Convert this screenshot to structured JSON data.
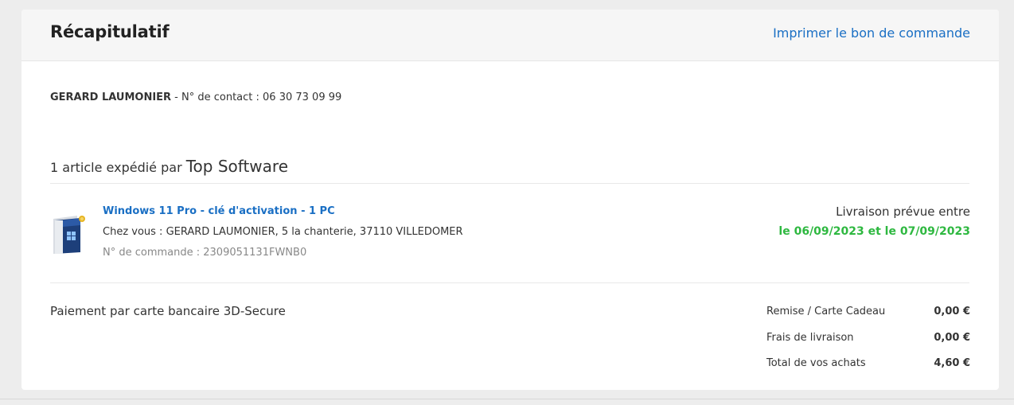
{
  "header": {
    "title": "Récapitulatif",
    "print_link": "Imprimer le bon de commande"
  },
  "contact": {
    "name": "GERARD LAUMONIER",
    "details": " - N° de contact : 06 30 73 09 99"
  },
  "shipment": {
    "prefix": "1 article expédié par ",
    "seller": "Top Software"
  },
  "product": {
    "image_icon": "windows-box-icon",
    "name": "Windows 11 Pro - clé d'activation - 1 PC",
    "address": "Chez vous : GERARD LAUMONIER, 5 la chanterie, 37110 VILLEDOMER",
    "order_number": "N° de commande : 2309051131FWNB0"
  },
  "delivery": {
    "label": "Livraison prévue entre",
    "dates": "le 06/09/2023 et le 07/09/2023",
    "color": "#2eb840"
  },
  "payment": {
    "method": "Paiement par carte bancaire 3D-Secure"
  },
  "totals": [
    {
      "label": "Remise / Carte Cadeau",
      "value": "0,00 €"
    },
    {
      "label": "Frais de livraison",
      "value": "0,00 €"
    },
    {
      "label": "Total de vos achats",
      "value": "4,60 €"
    }
  ],
  "colors": {
    "link": "#1a6fc4",
    "background": "#ededed",
    "card": "#ffffff"
  }
}
